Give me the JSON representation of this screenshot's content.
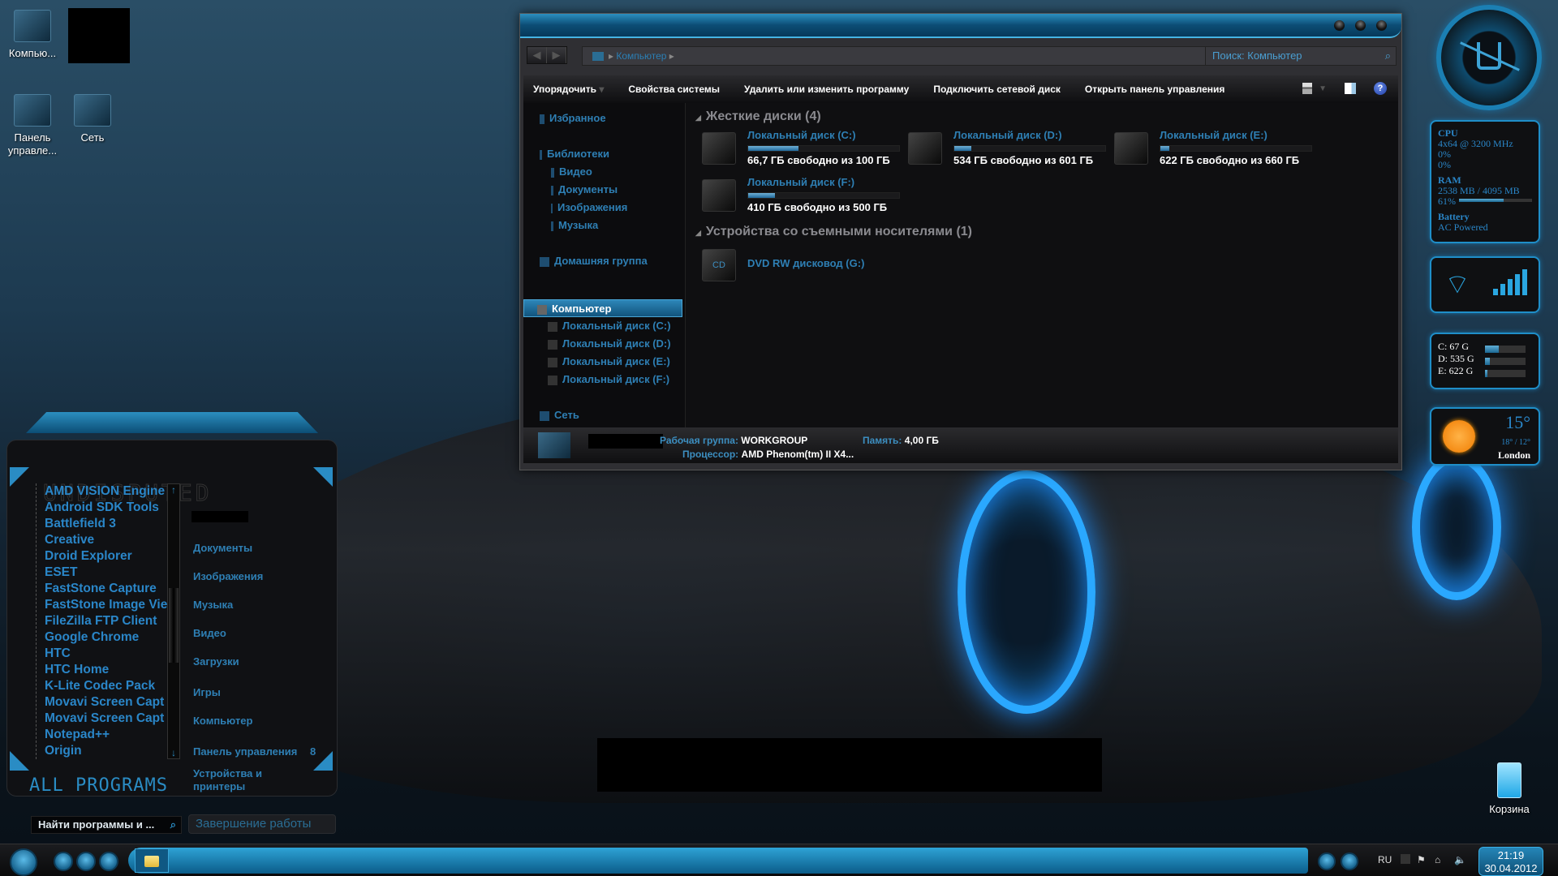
{
  "desktop": {
    "icons": [
      {
        "label": "Компью..."
      },
      {
        "label": "Панель управле..."
      },
      {
        "label": "Сеть"
      },
      {
        "label": "Корзина"
      }
    ]
  },
  "explorer": {
    "address": {
      "crumb": "Компьютер"
    },
    "search": {
      "placeholder": "Поиск: Компьютер"
    },
    "commands": [
      "Упорядочить",
      "Свойства системы",
      "Удалить или изменить программу",
      "Подключить сетевой диск",
      "Открыть панель управления"
    ],
    "nav": {
      "favorites": "Избранное",
      "libraries": "Библиотеки",
      "library_items": [
        "Видео",
        "Документы",
        "Изображения",
        "Музыка"
      ],
      "homegroup": "Домашняя группа",
      "computer": "Компьютер",
      "drives": [
        "Локальный диск (C:)",
        "Локальный диск (D:)",
        "Локальный диск (E:)",
        "Локальный диск (F:)"
      ],
      "network": "Сеть"
    },
    "groups": {
      "hard_disks": "Жесткие диски (4)",
      "removable": "Устройства со съемными носителями (1)"
    },
    "drives": [
      {
        "name": "Локальный диск (C:)",
        "free": "66,7 ГБ свободно из 100 ГБ",
        "used_fraction": 0.333
      },
      {
        "name": "Локальный диск (D:)",
        "free": "534 ГБ свободно из 601 ГБ",
        "used_fraction": 0.111
      },
      {
        "name": "Локальный диск (E:)",
        "free": "622 ГБ свободно из 660 ГБ",
        "used_fraction": 0.058
      },
      {
        "name": "Локальный диск (F:)",
        "free": "410 ГБ свободно из 500 ГБ",
        "used_fraction": 0.18
      }
    ],
    "dvd": {
      "name": "DVD RW дисковод (G:)"
    },
    "details": {
      "workgroup_label": "Рабочая группа:",
      "workgroup": "WORKGROUP",
      "memory_label": "Память:",
      "memory": "4,00 ГБ",
      "cpu_label": "Процессор:",
      "cpu": "AMD Phenom(tm) II X4..."
    }
  },
  "start_menu": {
    "brand": "UNDISPUTED",
    "programs": [
      "AMD VISION Engine",
      "Android SDK Tools",
      "Battlefield 3",
      "Creative",
      "Droid Explorer",
      "ESET",
      "FastStone Capture",
      "FastStone Image Vie",
      "FileZilla FTP Client",
      "Google Chrome",
      "HTC",
      "HTC Home",
      "K-Lite Codec Pack",
      "Movavi Screen Capt",
      "Movavi Screen Capt",
      "Notepad++",
      "Origin"
    ],
    "right_links": [
      "Документы",
      "Изображения",
      "Музыка",
      "Видео",
      "Загрузки",
      "Игры",
      "Компьютер",
      "Панель управления",
      "Устройства и принтеры"
    ],
    "control_panel_badge": "8",
    "all_programs": "ALL PROGRAMS",
    "search_placeholder": "Найти программы и ...",
    "shutdown": "Завершение работы"
  },
  "gadgets": {
    "cpu": {
      "title": "CPU",
      "spec": "4x64 @ 3200 MHz",
      "core1": "0%",
      "core2": "0%",
      "core1_fraction": 0,
      "core2_fraction": 0
    },
    "ram": {
      "title": "RAM",
      "usage": "2538 MB / 4095 MB",
      "percent": "61%",
      "fraction": 0.61
    },
    "battery": {
      "title": "Battery",
      "status": "AC Powered"
    },
    "disks": [
      {
        "label": "C: 67 G",
        "used_fraction": 0.33
      },
      {
        "label": "D: 535 G",
        "used_fraction": 0.11
      },
      {
        "label": "E: 622 G",
        "used_fraction": 0.06
      }
    ],
    "weather": {
      "temp": "15°",
      "range": "18° / 12°",
      "city": "London"
    }
  },
  "taskbar": {
    "lang": "RU",
    "time": "21:19",
    "date": "30.04.2012"
  }
}
